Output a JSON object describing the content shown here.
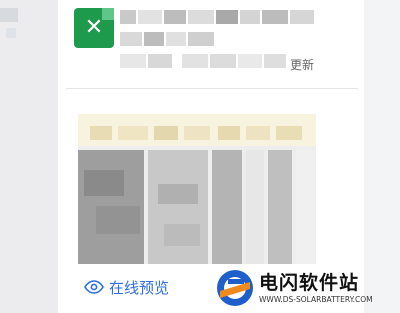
{
  "file_card": {
    "icon": "excel-file-icon",
    "icon_glyph": "✕",
    "update_label": "更新"
  },
  "preview": {
    "online_preview_label": "在线预览",
    "icon": "eye-icon"
  },
  "watermark": {
    "name": "电闪软件站",
    "url": "WWW.DS-SOLARBATTERY.COM"
  },
  "colors": {
    "excel_green": "#1e9a4d",
    "link_blue": "#2f6fe0",
    "watermark_blue": "#1f5fc9",
    "watermark_orange": "#f08a1c"
  }
}
